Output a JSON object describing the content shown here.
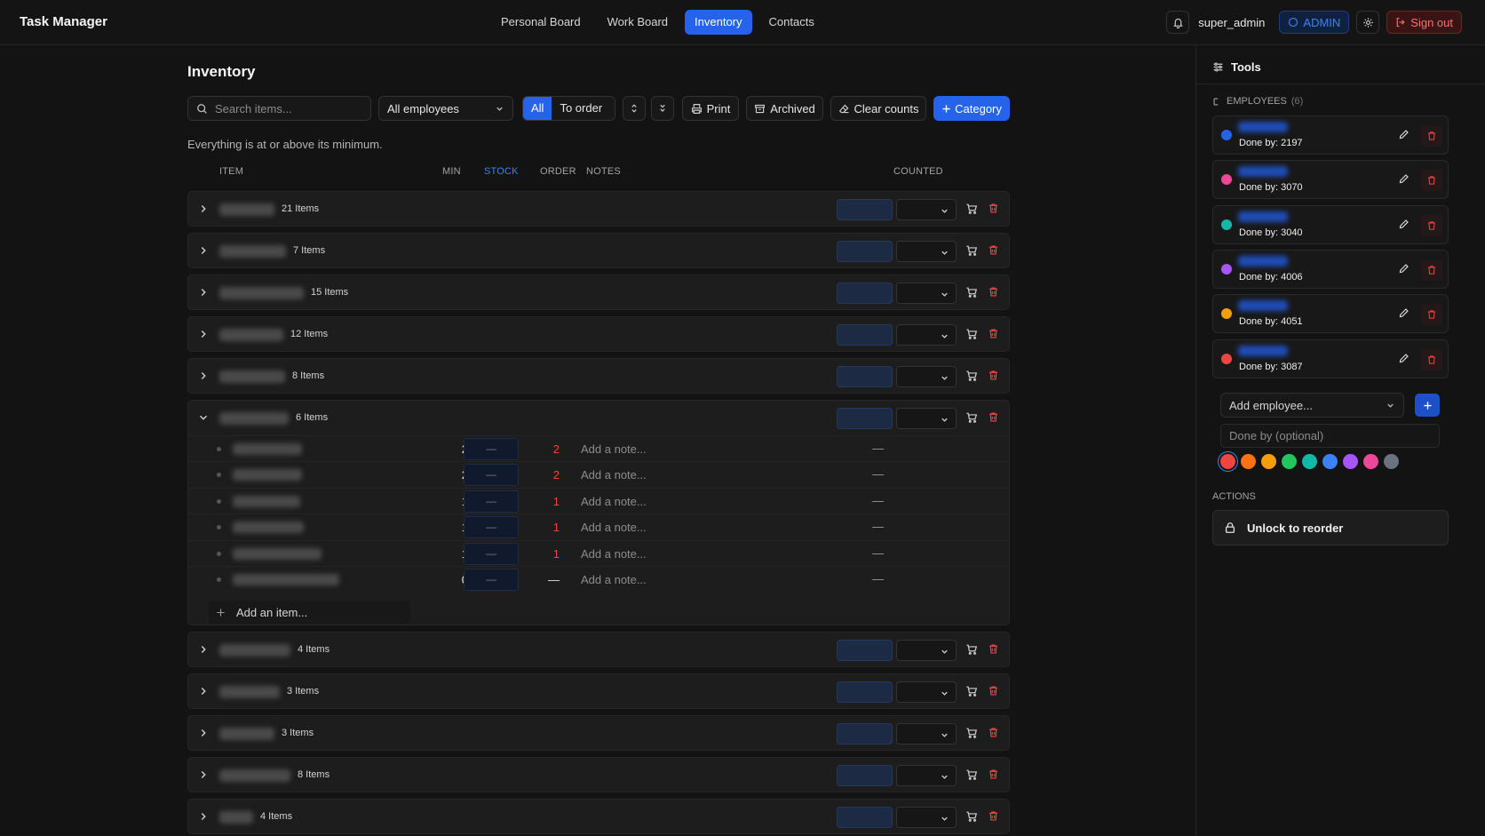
{
  "app": {
    "title": "Task Manager"
  },
  "nav": {
    "tabs": [
      {
        "label": "Personal Board"
      },
      {
        "label": "Work Board"
      },
      {
        "label": "Inventory"
      },
      {
        "label": "Contacts"
      }
    ],
    "active": "Inventory"
  },
  "header": {
    "username": "super_admin",
    "role_badge": "ADMIN",
    "signout_label": "Sign out"
  },
  "page": {
    "title": "Inventory",
    "info": "Everything is at or above its minimum."
  },
  "toolbar": {
    "search_placeholder": "Search items...",
    "employee_filter": "All employees",
    "segment_all": "All",
    "segment_to_order": "To order",
    "print_label": "Print",
    "archived_label": "Archived",
    "clear_label": "Clear counts",
    "category_label": "Category"
  },
  "table_headers": {
    "item": "ITEM",
    "min": "MIN",
    "stock": "STOCK",
    "order": "ORDER",
    "notes": "NOTES",
    "counted": "COUNTED"
  },
  "categories": [
    {
      "count_label": "21 Items",
      "expanded": false
    },
    {
      "count_label": "7 Items",
      "expanded": false
    },
    {
      "count_label": "15 Items",
      "expanded": false
    },
    {
      "count_label": "12 Items",
      "expanded": false
    },
    {
      "count_label": "8 Items",
      "expanded": false
    },
    {
      "count_label": "6 Items",
      "expanded": true
    },
    {
      "count_label": "4 Items",
      "expanded": false
    },
    {
      "count_label": "3 Items",
      "expanded": false
    },
    {
      "count_label": "3 Items",
      "expanded": false
    },
    {
      "count_label": "8 Items",
      "expanded": false
    },
    {
      "count_label": "4 Items",
      "expanded": false
    }
  ],
  "expanded_items": [
    {
      "min": "2",
      "stock": "—",
      "order": "2",
      "note_placeholder": "Add a note...",
      "counted": "—"
    },
    {
      "min": "2",
      "stock": "—",
      "order": "2",
      "note_placeholder": "Add a note...",
      "counted": "—"
    },
    {
      "min": "1",
      "stock": "—",
      "order": "1",
      "note_placeholder": "Add a note...",
      "counted": "—"
    },
    {
      "min": "1",
      "stock": "—",
      "order": "1",
      "note_placeholder": "Add a note...",
      "counted": "—"
    },
    {
      "min": "1",
      "stock": "—",
      "order": "1",
      "note_placeholder": "Add a note...",
      "counted": "—"
    },
    {
      "min": "0",
      "stock": "—",
      "order": "—",
      "note_placeholder": "Add a note...",
      "counted": "—"
    }
  ],
  "add_item_label": "Add an item...",
  "sidebar": {
    "title": "Tools",
    "employees_header": "EMPLOYEES",
    "employees_count": "(6)",
    "employees": [
      {
        "done_by": "Done by: 2197",
        "color": "#2563eb"
      },
      {
        "done_by": "Done by: 3070",
        "color": "#ec4899"
      },
      {
        "done_by": "Done by: 3040",
        "color": "#14b8a6"
      },
      {
        "done_by": "Done by: 4006",
        "color": "#a855f7"
      },
      {
        "done_by": "Done by: 4051",
        "color": "#f59e0b"
      },
      {
        "done_by": "Done by: 3087",
        "color": "#ef4444"
      }
    ],
    "add_employee_placeholder": "Add employee...",
    "done_by_placeholder": "Done by (optional)",
    "swatches": [
      "#ef4444",
      "#f97316",
      "#f59e0b",
      "#22c55e",
      "#14b8a6",
      "#3b82f6",
      "#a855f7",
      "#ec4899",
      "#6b7280"
    ],
    "selected_swatch": "#ef4444",
    "actions_header": "ACTIONS",
    "unlock_label": "Unlock to reorder"
  }
}
